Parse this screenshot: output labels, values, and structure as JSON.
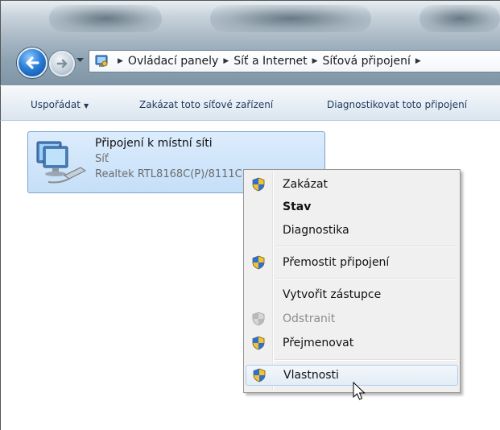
{
  "address_bar": {
    "crumbs": [
      "Ovládací panely",
      "Síť a Internet",
      "Síťová připojení"
    ]
  },
  "command_bar": {
    "organize": "Uspořádat",
    "disable_device": "Zakázat toto síťové zařízení",
    "diagnose": "Diagnostikovat toto připojení"
  },
  "connection": {
    "name": "Připojení k místní síti",
    "network": "Síť",
    "adapter": "Realtek RTL8168C(P)/8111C(P) Family PCI-E Gigabit Ethernet NIC (NDIS 6.20)",
    "icon": "network-connection-icon"
  },
  "context_menu": {
    "items": [
      {
        "label": "Zakázat",
        "icon": "uac-shield-icon"
      },
      {
        "label": "Stav"
      },
      {
        "label": "Diagnostika"
      },
      {
        "label": "Přemostit připojení",
        "icon": "uac-shield-icon"
      },
      {
        "label": "Vytvořit zástupce"
      },
      {
        "label": "Odstranit",
        "icon": "uac-shield-icon",
        "disabled": true
      },
      {
        "label": "Přejmenovat",
        "icon": "uac-shield-icon"
      },
      {
        "label": "Vlastnosti",
        "icon": "uac-shield-icon",
        "highlighted": true
      }
    ]
  },
  "colors": {
    "selection": "#c5dff8",
    "menu_background": "#f0f0f0",
    "command_text": "#1e395b"
  }
}
